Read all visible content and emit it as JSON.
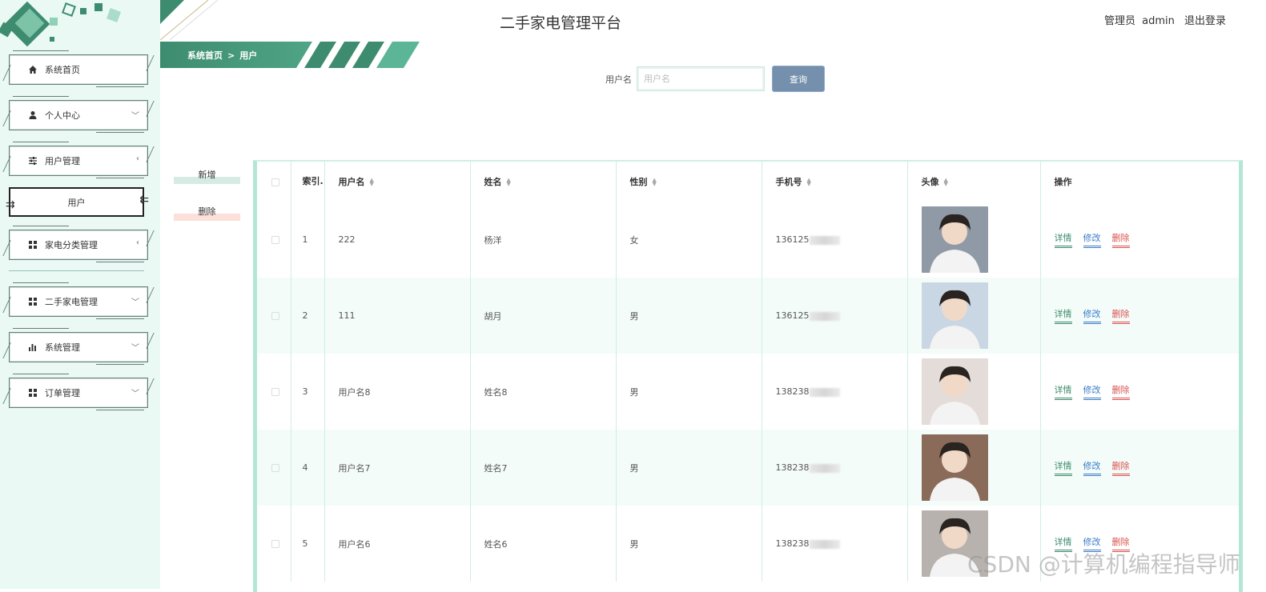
{
  "app": {
    "title": "二手家电管理平台"
  },
  "user": {
    "role_label": "管理员",
    "name": "admin",
    "logout_label": "退出登录"
  },
  "breadcrumb": {
    "home": "系统首页",
    "separator": ">",
    "current": "用户"
  },
  "sidebar": {
    "items": [
      {
        "label": "系统首页",
        "icon": "home-icon"
      },
      {
        "label": "个人中心",
        "icon": "person-icon",
        "chevron": "down"
      },
      {
        "label": "用户管理",
        "icon": "sliders-icon",
        "chevron": "left"
      },
      {
        "label": "用户",
        "sub": true
      },
      {
        "label": "家电分类管理",
        "icon": "grid-icon",
        "chevron": "left"
      },
      {
        "label": "二手家电管理",
        "icon": "grid-icon",
        "chevron": "down"
      },
      {
        "label": "系统管理",
        "icon": "bar-chart-icon",
        "chevron": "down"
      },
      {
        "label": "订单管理",
        "icon": "grid-icon",
        "chevron": "down"
      }
    ]
  },
  "search": {
    "label": "用户名",
    "placeholder": "用户名",
    "value": "",
    "button": "查询"
  },
  "actions": {
    "add": "新增",
    "delete": "删除"
  },
  "table": {
    "headers": {
      "index": "索引.",
      "username": "用户名",
      "name": "姓名",
      "gender": "性别",
      "phone": "手机号",
      "avatar": "头像",
      "ops": "操作"
    },
    "ops": {
      "detail": "详情",
      "edit": "修改",
      "delete": "删除"
    },
    "rows": [
      {
        "index": "1",
        "username": "222",
        "name": "杨洋",
        "gender": "女",
        "phone": "136125"
      },
      {
        "index": "2",
        "username": "111",
        "name": "胡月",
        "gender": "男",
        "phone": "136125"
      },
      {
        "index": "3",
        "username": "用户名8",
        "name": "姓名8",
        "gender": "男",
        "phone": "138238"
      },
      {
        "index": "4",
        "username": "用户名7",
        "name": "姓名7",
        "gender": "男",
        "phone": "138238"
      },
      {
        "index": "5",
        "username": "用户名6",
        "name": "姓名6",
        "gender": "男",
        "phone": "138238"
      }
    ]
  },
  "colors": {
    "primary": "#3b8a6b",
    "sidebar_bg": "#eaf9f4",
    "search_button": "#7590ad",
    "table_border": "#b3e6d6"
  },
  "watermark": "CSDN @计算机编程指导师"
}
